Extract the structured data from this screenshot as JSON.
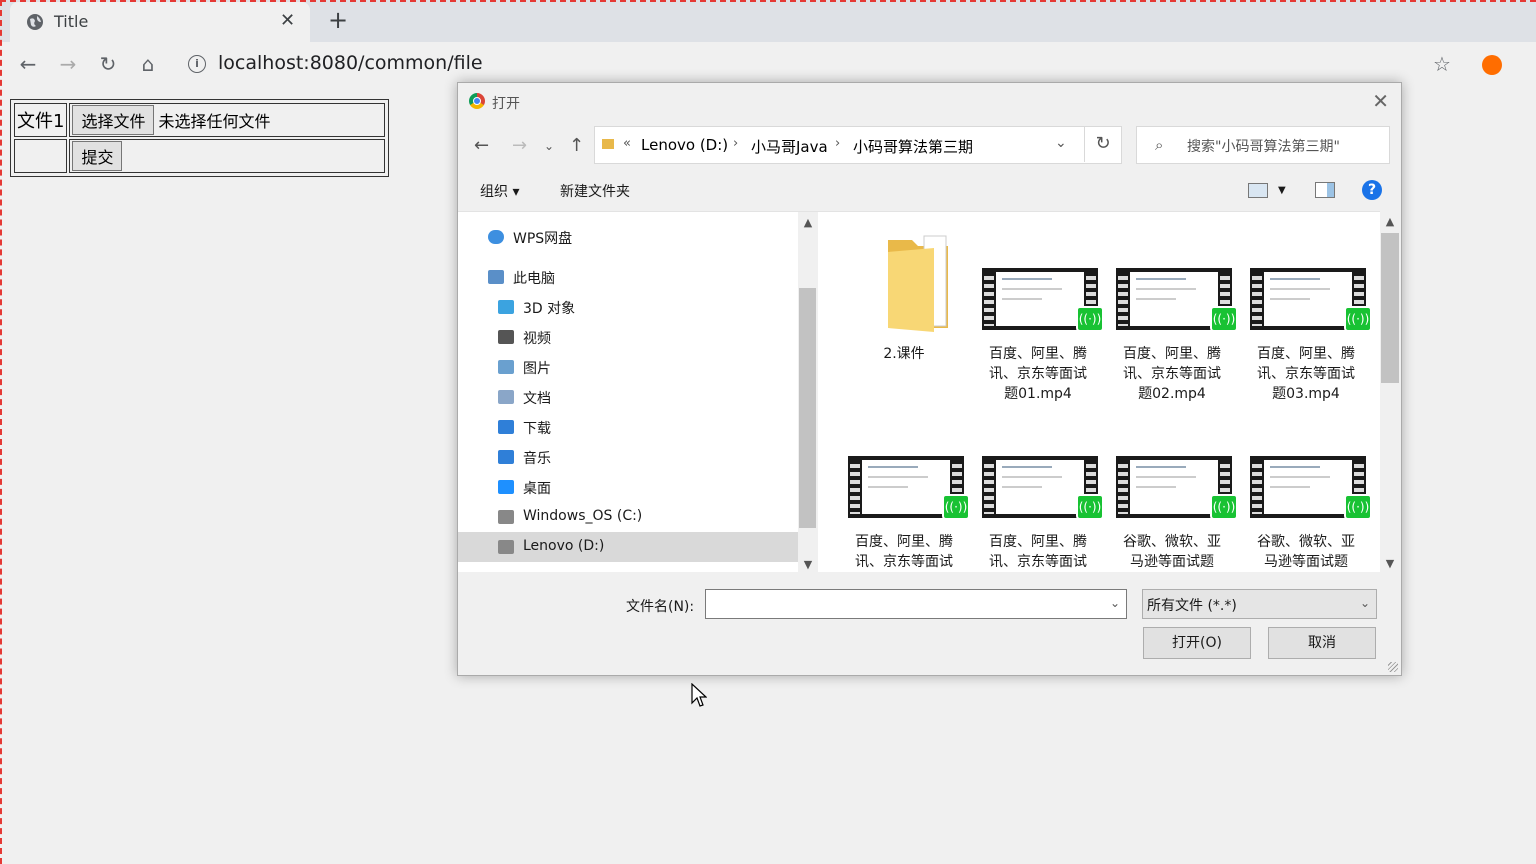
{
  "browser": {
    "tab_title": "Title",
    "url": "localhost:8080/common/file"
  },
  "form": {
    "row1_label": "文件1",
    "choose_file_button": "选择文件",
    "no_file_text": "未选择任何文件",
    "submit_button": "提交"
  },
  "dialog": {
    "title": "打开",
    "breadcrumb": {
      "overflow": "«",
      "items": [
        "Lenovo (D:)",
        "小马哥Java",
        "小码哥算法第三期"
      ]
    },
    "search_placeholder": "搜索\"小码哥算法第三期\"",
    "commands": {
      "organize": "组织 ▾",
      "new_folder": "新建文件夹"
    },
    "nav_items": [
      {
        "label": "WPS网盘",
        "icon": "cloud-icon"
      },
      {
        "label": "此电脑",
        "icon": "computer-icon"
      },
      {
        "label": "3D 对象",
        "icon": "cube-icon"
      },
      {
        "label": "视频",
        "icon": "video-icon"
      },
      {
        "label": "图片",
        "icon": "picture-icon"
      },
      {
        "label": "文档",
        "icon": "document-icon"
      },
      {
        "label": "下载",
        "icon": "download-icon"
      },
      {
        "label": "音乐",
        "icon": "music-icon"
      },
      {
        "label": "桌面",
        "icon": "desktop-icon"
      },
      {
        "label": "Windows_OS (C:)",
        "icon": "drive-icon"
      },
      {
        "label": "Lenovo (D:)",
        "icon": "drive-icon",
        "selected": true
      }
    ],
    "files": [
      {
        "name": "2.课件",
        "type": "folder"
      },
      {
        "name_lines": [
          "百度、阿里、腾",
          "讯、京东等面试",
          "题01.mp4"
        ],
        "type": "video"
      },
      {
        "name_lines": [
          "百度、阿里、腾",
          "讯、京东等面试",
          "题02.mp4"
        ],
        "type": "video"
      },
      {
        "name_lines": [
          "百度、阿里、腾",
          "讯、京东等面试",
          "题03.mp4"
        ],
        "type": "video"
      },
      {
        "name_lines": [
          "百度、阿里、腾",
          "讯、京东等面试"
        ],
        "type": "video"
      },
      {
        "name_lines": [
          "百度、阿里、腾",
          "讯、京东等面试"
        ],
        "type": "video"
      },
      {
        "name_lines": [
          "谷歌、微软、亚",
          "马逊等面试题"
        ],
        "type": "video"
      },
      {
        "name_lines": [
          "谷歌、微软、亚",
          "马逊等面试题"
        ],
        "type": "video"
      }
    ],
    "filename_label": "文件名(N):",
    "filename_value": "",
    "filetype_value": "所有文件 (*.*)",
    "open_button": "打开(O)",
    "cancel_button": "取消"
  }
}
